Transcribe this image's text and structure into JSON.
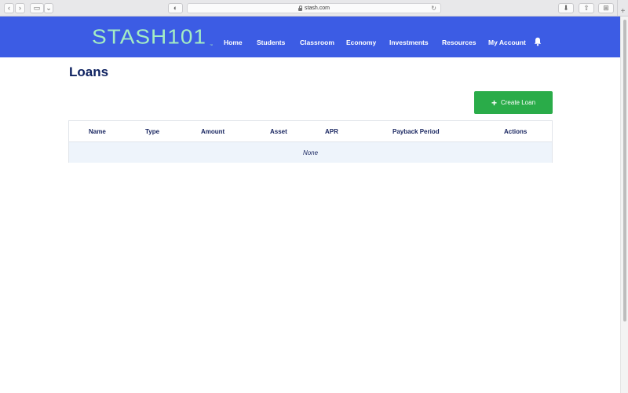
{
  "browser": {
    "url": "stash.com",
    "buttons": {
      "back": "‹",
      "forward": "›",
      "sidebar": "▭",
      "sidebar_menu": "⌄",
      "privacy": "◐",
      "downloads": "⬇",
      "share": "⇧",
      "tabs": "⊞",
      "new_tab": "+",
      "reload": "↻"
    }
  },
  "nav": {
    "logo": "STASH101",
    "trademark": "™",
    "items": [
      "Home",
      "Students",
      "Classroom",
      "Economy",
      "Investments",
      "Resources",
      "My Account"
    ],
    "icons": [
      "bell-icon"
    ],
    "colors": {
      "background": "#3c5ce4",
      "logo": "#a4edc4"
    }
  },
  "page": {
    "title": "Loans",
    "create_button": {
      "icon": "+",
      "label": "Create Loan",
      "color": "#2aac49"
    }
  },
  "table": {
    "columns": [
      "Name",
      "Type",
      "Amount",
      "Asset",
      "APR",
      "Payback Period",
      "Actions"
    ],
    "rows": [],
    "empty_text": "None"
  }
}
